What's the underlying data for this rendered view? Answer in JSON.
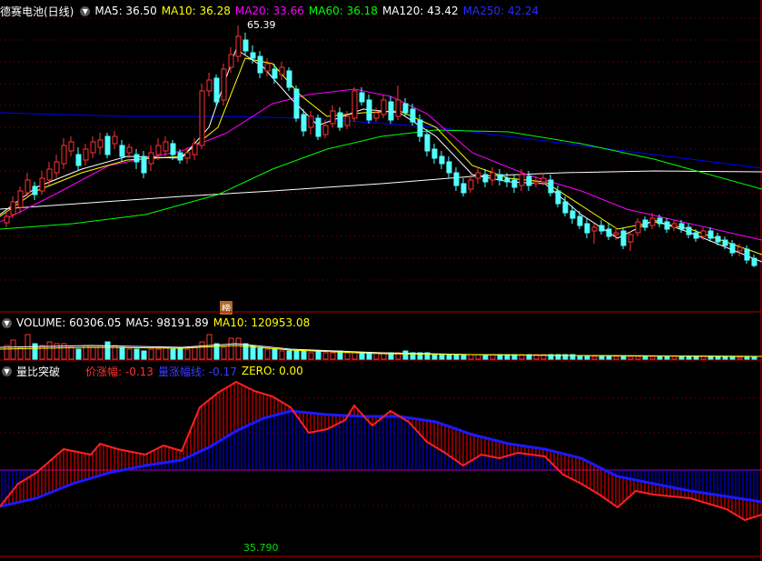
{
  "main_header": {
    "stock_name": "德赛电池(日线)",
    "ma5": "MA5: 36.50",
    "ma10": "MA10: 36.28",
    "ma20": "MA20: 33.66",
    "ma60": "MA60: 36.18",
    "ma120": "MA120: 43.42",
    "ma250": "MA250: 42.24"
  },
  "high_label": "65.39",
  "rank_badge": "榜",
  "volume_header": {
    "volume": "VOLUME: 60306.05",
    "ma5": "MA5: 98191.89",
    "ma10": "MA10: 120953.08"
  },
  "indicator_header": {
    "name": "量比突破",
    "price_change": "价涨幅: -0.13",
    "volume_change": "量涨幅线: -0.17",
    "zero": "ZERO: 0.00"
  },
  "bottom_value": "35.790",
  "colors": {
    "background": "#000000",
    "up": "#ff3232",
    "down": "#54ffff",
    "ma5": "#ffffff",
    "ma10": "#ffff00",
    "ma20": "#ff00ff",
    "ma60": "#00ff00",
    "ma120": "#ffffff",
    "ma250": "#0000ff",
    "grid": "#8b0000"
  }
}
